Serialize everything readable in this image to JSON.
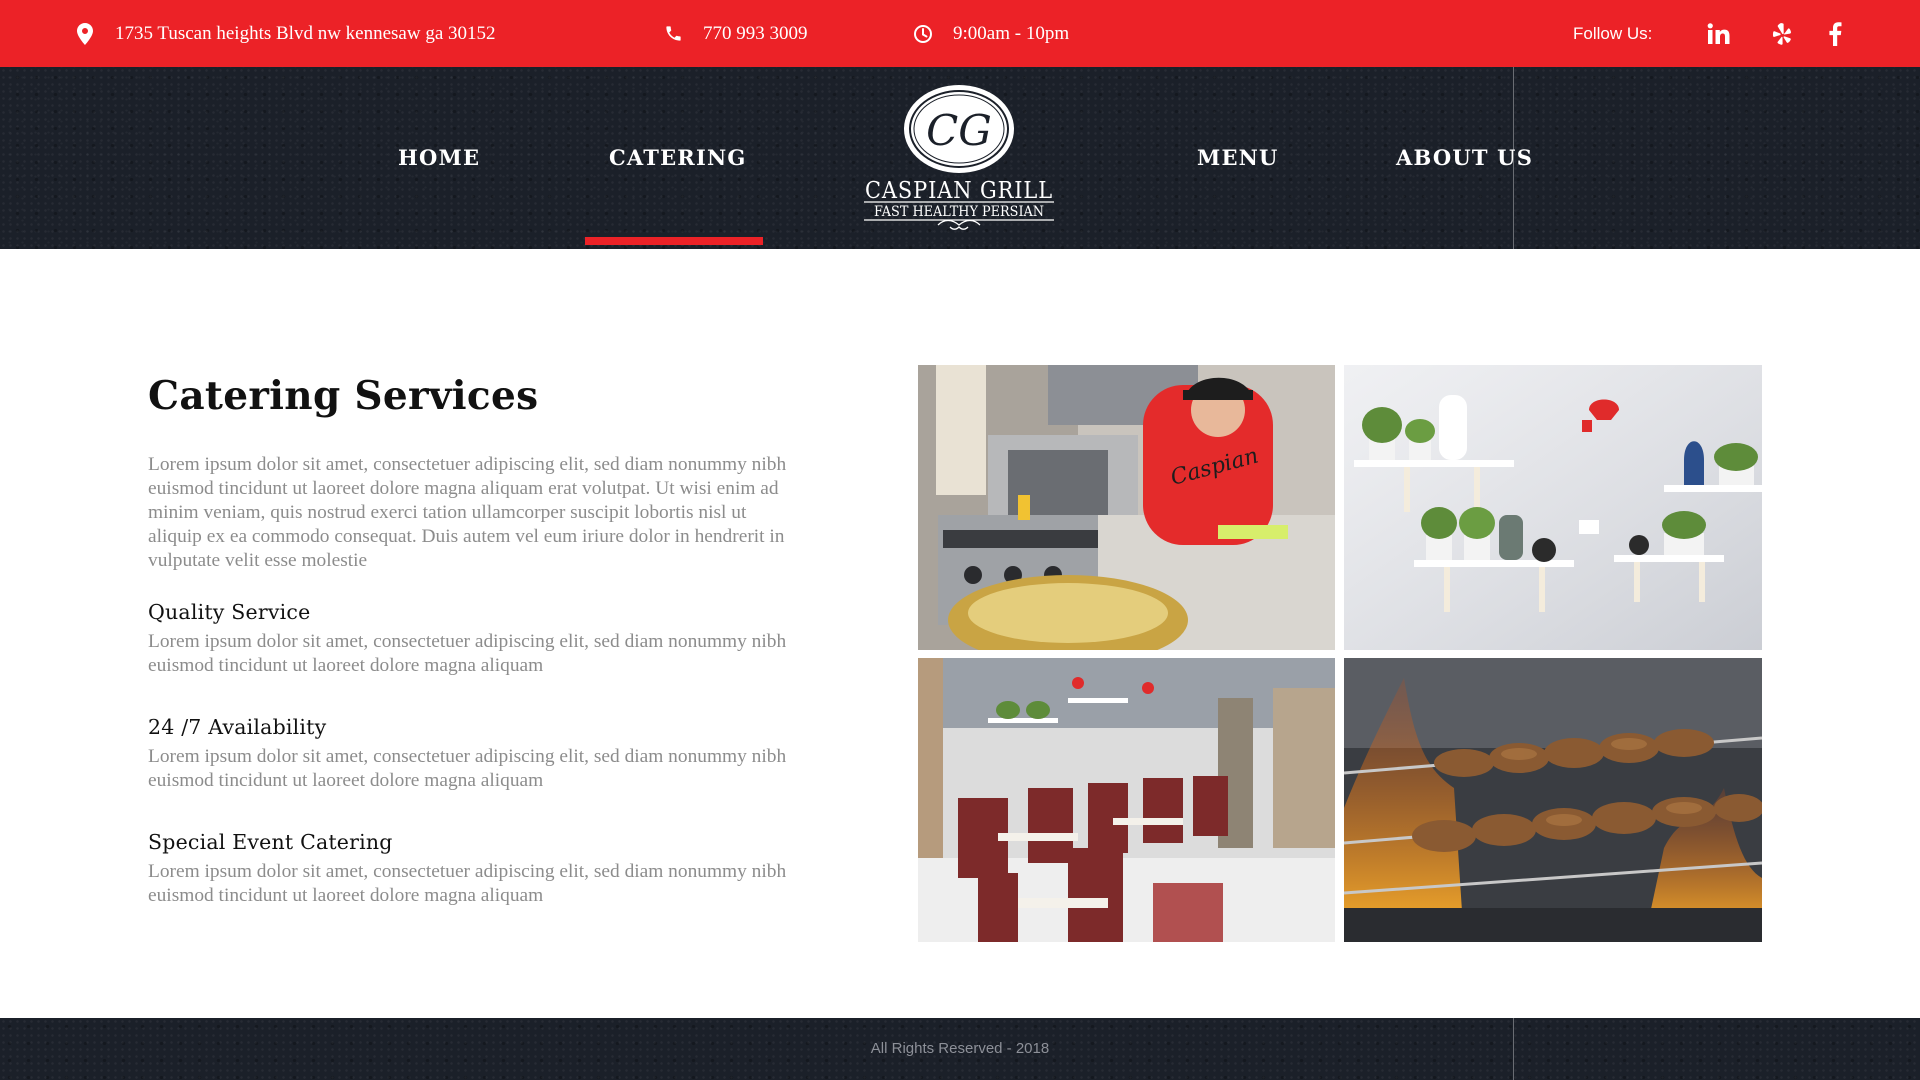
{
  "topbar": {
    "background": "#ec2227",
    "address": "1735 Tuscan heights Blvd nw kennesaw ga 30152",
    "phone": "770 993 3009",
    "hours": "9:00am - 10pm",
    "follow_label": "Follow Us:",
    "social": [
      "linkedin-icon",
      "yelp-icon",
      "facebook-icon"
    ],
    "icons": {
      "address": "map-pin-icon",
      "phone": "phone-icon",
      "hours": "clock-icon"
    }
  },
  "nav": {
    "items": [
      {
        "label": "HOME"
      },
      {
        "label": "CATERING",
        "active": true
      },
      {
        "label": "MENU"
      },
      {
        "label": "ABOUT US"
      }
    ],
    "active_color": "#ec2227"
  },
  "logo": {
    "monogram": "CG",
    "name": "CASPIAN GRILL",
    "tagline": "FAST HEALTHY PERSIAN"
  },
  "main": {
    "title": "Catering Services",
    "intro": "Lorem ipsum dolor sit amet, consectetuer adipiscing elit, sed diam nonummy nibh euismod tincidunt ut laoreet dolore magna aliquam erat volutpat. Ut wisi enim ad minim veniam, quis nostrud exerci tation ulla­mcorper suscipit lobortis nisl ut aliquip ex ea commodo consequat. Duis autem vel eum iriure dolor in hendrerit in vulputate velit esse molestie",
    "features": [
      {
        "title": "Quality Service",
        "text": "Lorem ipsum dolor sit amet, consectetuer adipiscing elit, sed diam nonummy nibh euismod tincidunt ut laoreet dolore magna aliquam"
      },
      {
        "title": "24 /7 Availability",
        "text": "Lorem ipsum dolor sit amet, consectetuer adipiscing elit, sed diam nonummy nibh euismod tincidunt ut laoreet dolore magna aliquam"
      },
      {
        "title": "Special Event Catering",
        "text": "Lorem ipsum dolor sit amet, consectetuer adipiscing elit, sed diam nonummy nibh euismod tincidunt ut laoreet dolore magna aliquam"
      }
    ],
    "photos": [
      "kitchen-photo",
      "wall-shelves-photo",
      "dining-room-photo",
      "kebab-grill-photo"
    ]
  },
  "footer": {
    "copyright": "All Rights Reserved - 2018"
  }
}
